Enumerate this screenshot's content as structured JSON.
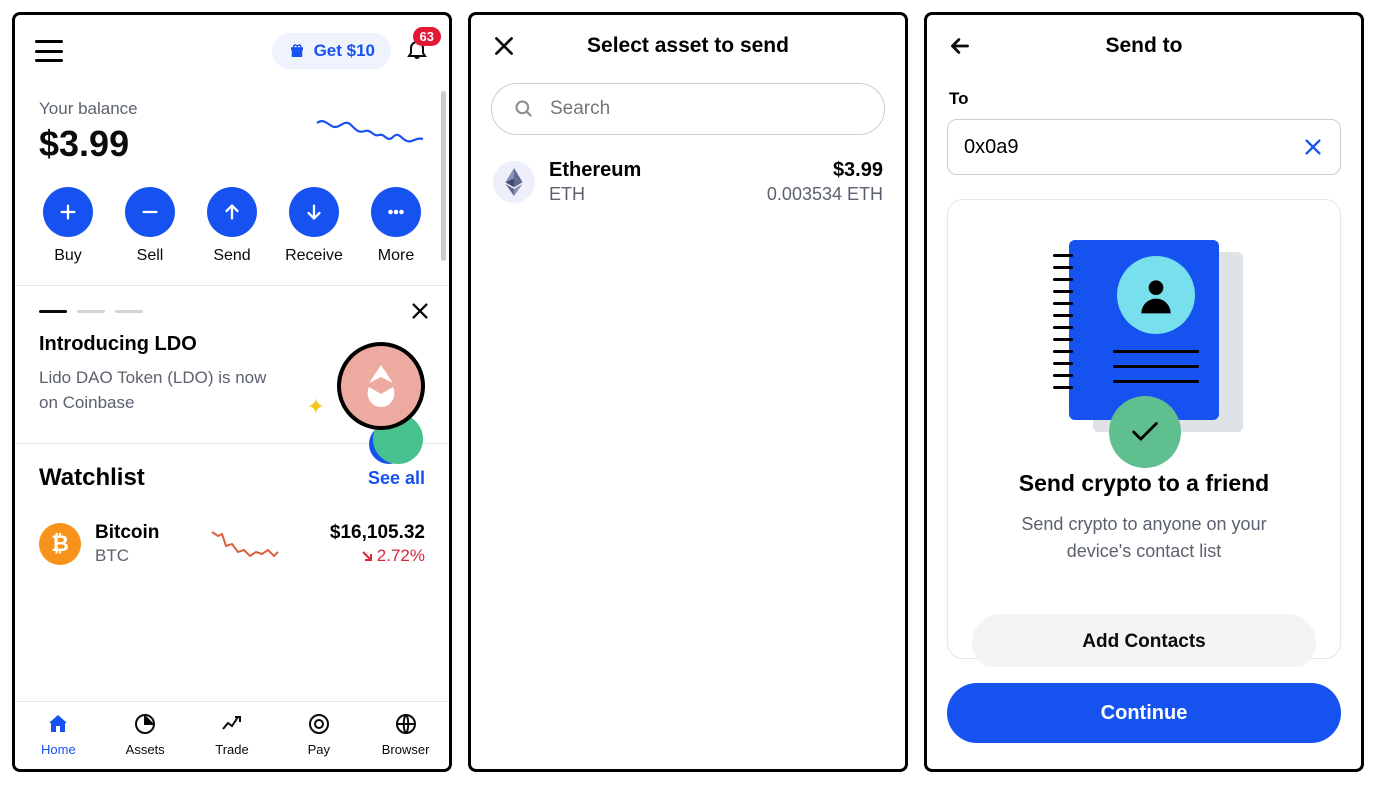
{
  "screen1": {
    "promo_pill": "Get $10",
    "notif_count": "63",
    "balance_label": "Your balance",
    "balance_value": "$3.99",
    "actions": {
      "buy": "Buy",
      "sell": "Sell",
      "send": "Send",
      "receive": "Receive",
      "more": "More"
    },
    "promo": {
      "title": "Introducing LDO",
      "body": "Lido DAO Token (LDO) is now on Coinbase"
    },
    "watchlist": {
      "title": "Watchlist",
      "see_all": "See all",
      "item": {
        "name": "Bitcoin",
        "ticker": "BTC",
        "price": "$16,105.32",
        "change": "2.72%"
      }
    },
    "tabs": {
      "home": "Home",
      "assets": "Assets",
      "trade": "Trade",
      "pay": "Pay",
      "browser": "Browser"
    }
  },
  "screen2": {
    "title": "Select asset to send",
    "search_placeholder": "Search",
    "asset": {
      "name": "Ethereum",
      "ticker": "ETH",
      "usd": "$3.99",
      "amount": "0.003534 ETH"
    }
  },
  "screen3": {
    "title": "Send to",
    "to_label": "To",
    "to_value": "0x0a9",
    "card_title": "Send crypto to a friend",
    "card_body": "Send crypto to anyone on your device's contact list",
    "add_contacts": "Add Contacts",
    "continue": "Continue"
  }
}
